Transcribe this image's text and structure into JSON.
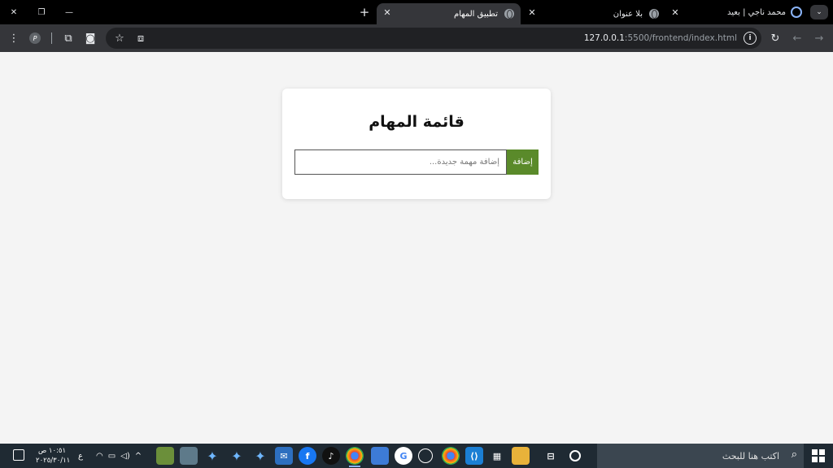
{
  "window_controls": {
    "close": "✕",
    "restore": "❐",
    "minimize": "—"
  },
  "tabs": [
    {
      "title": "تطبيق المهام",
      "close": "✕",
      "active": true
    },
    {
      "title": "بلا عنوان",
      "close": "✕",
      "active": false
    }
  ],
  "new_tab": "+",
  "profile": {
    "name": "محمد ناجي | بعيد"
  },
  "tab_search": "⌄",
  "toolbar": {
    "url_host": "127.0.0.1",
    "url_path": ":5500/frontend/index.html",
    "menu": "⋮",
    "profile_badge": "P",
    "extensions": "⧉",
    "screenshot": "◙",
    "star": "☆",
    "cast": "⧈",
    "reload": "↻",
    "back": "←",
    "forward": "→",
    "info": "i"
  },
  "page": {
    "title": "قائمة المهام",
    "input": {
      "placeholder": "إضافة مهمة جديدة...",
      "value": ""
    },
    "add_button": "إضافة",
    "accent_color": "#5a8a2a"
  },
  "taskbar": {
    "search_placeholder": "اكتب هنا للبحث",
    "clock_time": "١٠:٥١ ص",
    "clock_date": "٢٠٢٥/٣٠/١١",
    "language": "ع",
    "apps": [
      "task-view",
      "cortana",
      "file-explorer",
      "calculator",
      "vscode",
      "chrome",
      "openai",
      "chrome",
      "google",
      "feather",
      "chrome",
      "tiktok",
      "facebook",
      "mail",
      "star-app",
      "star-app",
      "star-app",
      "edge",
      "minecraft"
    ]
  }
}
